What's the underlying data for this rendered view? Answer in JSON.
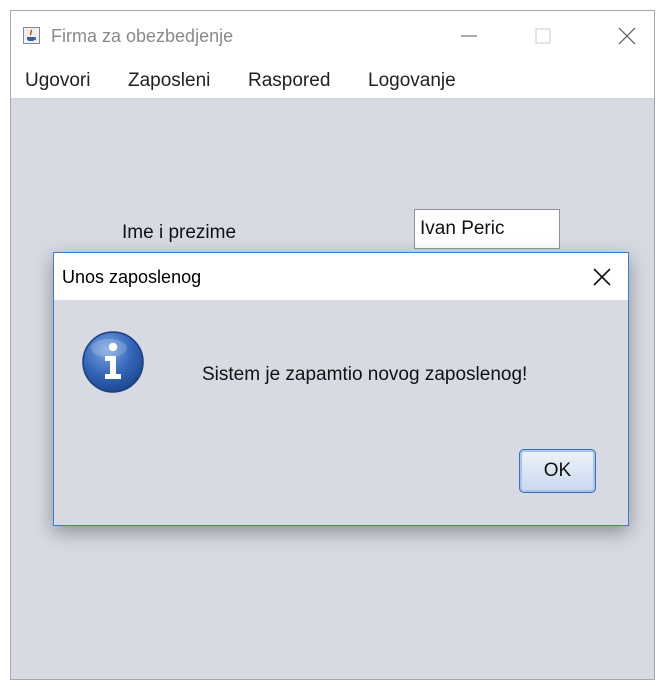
{
  "window": {
    "title": "Firma za obezbedjenje",
    "icon": "java-app-icon",
    "controls": {
      "minimize": "minimize-icon",
      "maximize": "maximize-icon",
      "close": "close-icon"
    }
  },
  "menubar": {
    "items": [
      {
        "label": "Ugovori"
      },
      {
        "label": "Zaposleni"
      },
      {
        "label": "Raspored"
      },
      {
        "label": "Logovanje"
      }
    ]
  },
  "form": {
    "name_label": "Ime i prezime",
    "name_value": "Ivan Peric"
  },
  "dialog": {
    "title": "Unos zaposlenog",
    "icon": "info-icon",
    "message": "Sistem je zapamtio novog zaposlenog!",
    "ok_label": "OK"
  },
  "colors": {
    "background": "#d7dae2",
    "dialog_border": "#3f7fc9",
    "info_blue": "#2f5fb2"
  }
}
